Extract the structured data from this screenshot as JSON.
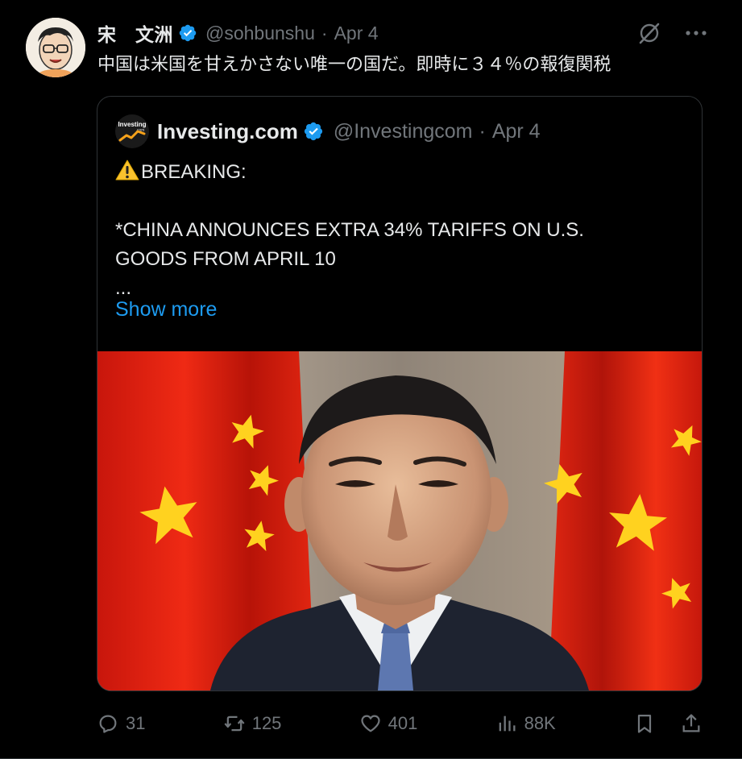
{
  "post": {
    "display_name": "宋　文洲",
    "handle": "@sohbunshu",
    "separator": "·",
    "time": "Apr 4",
    "text": "中国は米国を甘えかさない唯一の国だ。即時に３４％の報復関税",
    "avatar_icon": "caricature-avatar",
    "verified_icon": "verified-badge-icon"
  },
  "quote": {
    "display_name": "Investing.com",
    "handle": "@Investingcom",
    "separator": "·",
    "time": "Apr 4",
    "avatar_text": "Investing",
    "avatar_sub": ".com",
    "line1": "BREAKING:",
    "line2": "*CHINA ANNOUNCES EXTRA 34% TARIFFS ON U.S.",
    "line3": "GOODS FROM APRIL 10",
    "line4": "...",
    "show_more": "Show more",
    "media_icon": "photo-man-in-front-of-chinese-flags"
  },
  "actions": {
    "replies": "31",
    "reposts": "125",
    "likes": "401",
    "views": "88K"
  },
  "colors": {
    "background": "#000000",
    "text": "#e7e9ea",
    "muted": "#71767b",
    "link": "#1d9bf0",
    "verified": "#1d9bf0",
    "border": "#2f3336",
    "flag_red": "#de2910",
    "flag_star": "#ffde00"
  }
}
